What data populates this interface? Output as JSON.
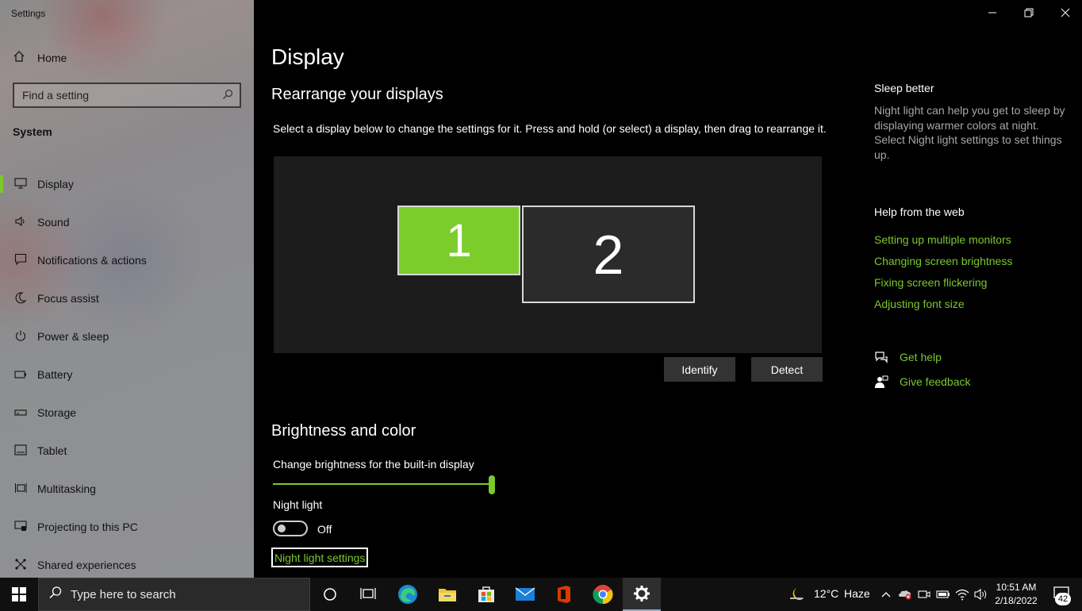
{
  "window": {
    "title": "Settings"
  },
  "sidebar": {
    "home_label": "Home",
    "search_placeholder": "Find a setting",
    "section": "System",
    "items": [
      {
        "label": "Display",
        "icon": "monitor-icon",
        "active": true
      },
      {
        "label": "Sound",
        "icon": "speaker-icon"
      },
      {
        "label": "Notifications & actions",
        "icon": "notification-icon"
      },
      {
        "label": "Focus assist",
        "icon": "moon-icon"
      },
      {
        "label": "Power & sleep",
        "icon": "power-icon"
      },
      {
        "label": "Battery",
        "icon": "battery-icon"
      },
      {
        "label": "Storage",
        "icon": "storage-icon"
      },
      {
        "label": "Tablet",
        "icon": "tablet-icon"
      },
      {
        "label": "Multitasking",
        "icon": "multitasking-icon"
      },
      {
        "label": "Projecting to this PC",
        "icon": "projecting-icon"
      },
      {
        "label": "Shared experiences",
        "icon": "shared-experiences-icon"
      }
    ]
  },
  "main": {
    "title": "Display",
    "rearrange_heading": "Rearrange your displays",
    "rearrange_desc": "Select a display below to change the settings for it. Press and hold (or select) a display, then drag to rearrange it.",
    "monitors": [
      "1",
      "2"
    ],
    "identify_label": "Identify",
    "detect_label": "Detect",
    "brightness_heading": "Brightness and color",
    "brightness_label": "Change brightness for the built-in display",
    "brightness_value": 1.0,
    "night_light_label": "Night light",
    "night_light_state": "Off",
    "night_light_settings_link": "Night light settings"
  },
  "right_panel": {
    "sleep_heading": "Sleep better",
    "sleep_text": "Night light can help you get to sleep by displaying warmer colors at night. Select Night light settings to set things up.",
    "help_heading": "Help from the web",
    "help_links": [
      "Setting up multiple monitors",
      "Changing screen brightness",
      "Fixing screen flickering",
      "Adjusting font size"
    ],
    "get_help": "Get help",
    "give_feedback": "Give feedback"
  },
  "taskbar": {
    "search_placeholder": "Type here to search",
    "weather_temp": "12°C",
    "weather_desc": "Haze",
    "time": "10:51 AM",
    "date": "2/18/2022",
    "notification_count": "42"
  },
  "colors": {
    "accent": "#7bc82f",
    "background": "#000000",
    "taskbar": "#101010"
  }
}
